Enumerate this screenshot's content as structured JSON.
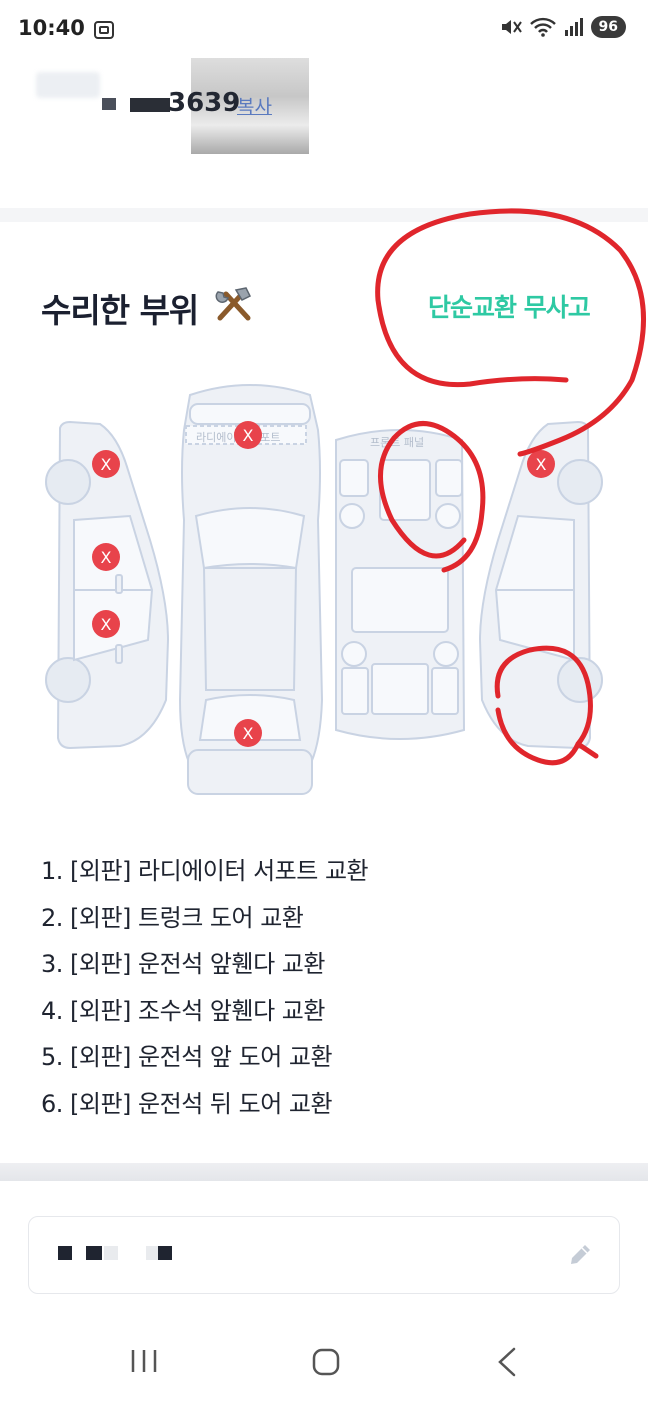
{
  "status_bar": {
    "time": "10:40",
    "battery": "96"
  },
  "car": {
    "plate_suffix": "3639",
    "copy_label": "복사"
  },
  "repair": {
    "title": "수리한 부위",
    "annotation": "단순교환 무사고",
    "diagram_labels": {
      "radiator_support": "라디에이터 서포트",
      "front_panel": "프론트 패널"
    },
    "items": [
      "1. [외판] 라디에이터 서포트 교환",
      "2. [외판] 트렁크 도어 교환",
      "3. [외판] 운전석 앞휀다 교환",
      "4. [외판] 조수석 앞휀다 교환",
      "5. [외판] 운전석 앞 도어 교환",
      "6. [외판] 운전석 뒤 도어 교환"
    ]
  },
  "colors": {
    "accent_text": "#2ec9a3",
    "marker_red": "#e8434b",
    "annotation_red": "#e0262c",
    "diagram_stroke": "#c9d3e3"
  },
  "icons": [
    "tools-icon",
    "pencil-icon",
    "mute-icon",
    "wifi-icon",
    "signal-icon"
  ]
}
